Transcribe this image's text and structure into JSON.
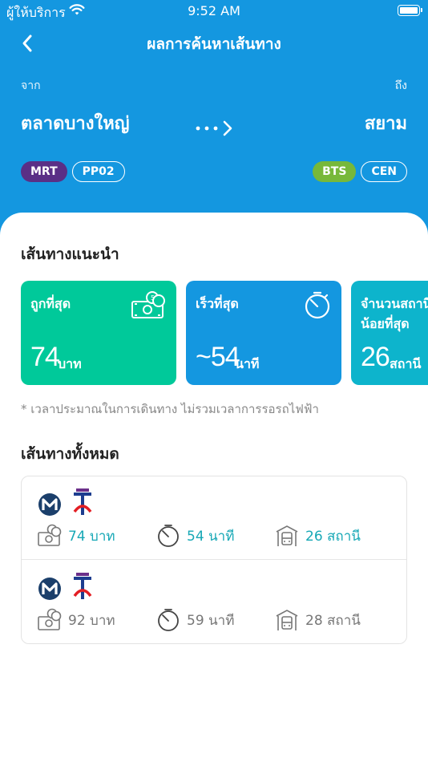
{
  "status_bar": {
    "carrier": "ผู้ให้บริการ",
    "time": "9:52 AM"
  },
  "nav": {
    "title": "ผลการค้นหาเส้นทาง"
  },
  "trip": {
    "from_label": "จาก",
    "to_label": "ถึง",
    "from_station": "ตลาดบางใหญ่",
    "to_station": "สยาม",
    "from_badges": [
      "MRT",
      "PP02"
    ],
    "to_badges": [
      "BTS",
      "CEN"
    ]
  },
  "recommended": {
    "heading": "เส้นทางแนะนำ",
    "cards": [
      {
        "title": "ถูกที่สุด",
        "value": "74",
        "unit": "บาท"
      },
      {
        "title": "เร็วที่สุด",
        "value": "~54",
        "unit": "นาที"
      },
      {
        "title_line1": "จำนวนสถานี",
        "title_line2": "น้อยที่สุด",
        "value": "26",
        "unit": "สถานี"
      }
    ],
    "note": "* เวลาประมาณในการเดินทาง ไม่รวมเวลาการรอรถไฟฟ้า"
  },
  "all_routes": {
    "heading": "เส้นทางทั้งหมด",
    "routes": [
      {
        "price": "74 บาท",
        "time": "54 นาที",
        "stations": "26 สถานี"
      },
      {
        "price": "92 บาท",
        "time": "59 นาที",
        "stations": "28 สถานี"
      }
    ]
  },
  "colors": {
    "header": "#1497e0",
    "card_cheap": "#00c99a",
    "card_fast": "#1497e0",
    "card_fewest": "#0db4cc",
    "mrt_badge": "#5a2f86",
    "bts_badge": "#77b83a",
    "highlight_text": "#17a8b6"
  },
  "icons": [
    "chevron-left-icon",
    "wifi-icon",
    "battery-icon",
    "route-arrow-icon",
    "money-icon",
    "stopwatch-icon",
    "train-station-icon",
    "mrt-logo-icon",
    "bts-logo-icon"
  ]
}
